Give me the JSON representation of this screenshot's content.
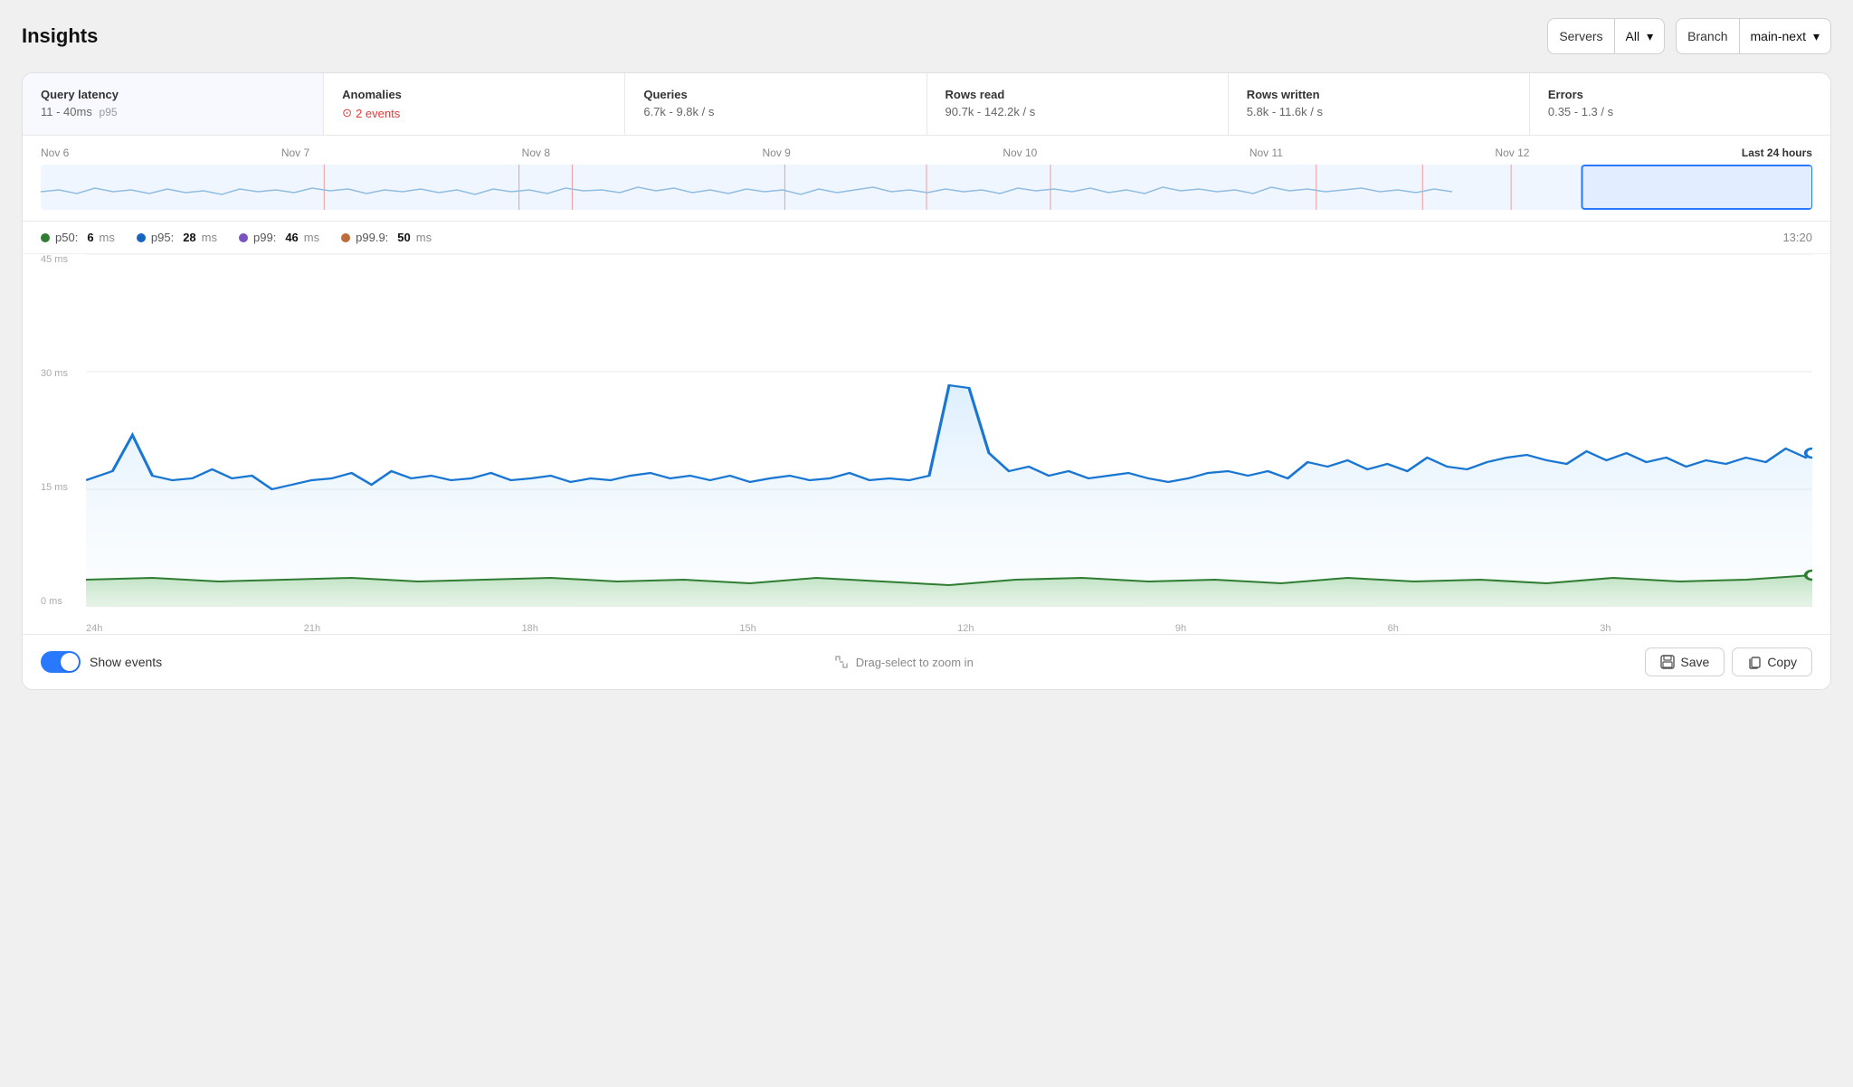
{
  "header": {
    "title": "Insights",
    "servers_label": "Servers",
    "servers_value": "All",
    "branch_label": "Branch",
    "branch_value": "main-next"
  },
  "stats": [
    {
      "id": "query-latency",
      "name": "Query latency",
      "value": "11 - 40ms",
      "unit": "p95",
      "active": true
    },
    {
      "id": "anomalies",
      "name": "Anomalies",
      "badge": "2 events",
      "is_alert": true
    },
    {
      "id": "queries",
      "name": "Queries",
      "value": "6.7k - 9.8k / s"
    },
    {
      "id": "rows-read",
      "name": "Rows read",
      "value": "90.7k - 142.2k / s"
    },
    {
      "id": "rows-written",
      "name": "Rows written",
      "value": "5.8k - 11.6k / s"
    },
    {
      "id": "errors",
      "name": "Errors",
      "value": "0.35 - 1.3 / s"
    }
  ],
  "timeline": {
    "dates": [
      "Nov 6",
      "Nov 7",
      "Nov 8",
      "Nov 9",
      "Nov 10",
      "Nov 11",
      "Nov 12",
      "Last 24 hours"
    ]
  },
  "legend": {
    "items": [
      {
        "id": "p50",
        "label": "p50:",
        "value": "6",
        "unit": "ms",
        "color": "#2e7d32"
      },
      {
        "id": "p95",
        "label": "p95:",
        "value": "28",
        "unit": "ms",
        "color": "#1565c0"
      },
      {
        "id": "p99",
        "label": "p99:",
        "value": "46",
        "unit": "ms",
        "color": "#7b52c0"
      },
      {
        "id": "p99_9",
        "label": "p99.9:",
        "value": "50",
        "unit": "ms",
        "color": "#bf6b3a"
      }
    ],
    "time": "13:20"
  },
  "chart": {
    "y_labels": [
      "45 ms",
      "30 ms",
      "15 ms",
      "0 ms"
    ],
    "x_labels": [
      "24h",
      "21h",
      "18h",
      "15h",
      "12h",
      "9h",
      "6h",
      "3h",
      ""
    ]
  },
  "bottom_bar": {
    "show_events_label": "Show events",
    "drag_hint": "Drag-select to zoom in",
    "save_label": "Save",
    "copy_label": "Copy"
  }
}
